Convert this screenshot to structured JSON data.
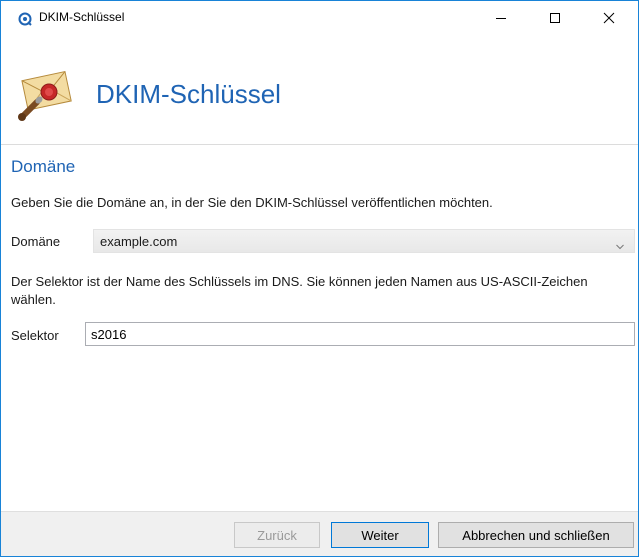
{
  "window": {
    "title": "DKIM-Schlüssel",
    "minimize_icon": "minimize-icon",
    "maximize_icon": "maximize-icon",
    "close_icon": "close-icon"
  },
  "header": {
    "title": "DKIM-Schlüssel",
    "icon": "sealed-envelope-icon"
  },
  "section": {
    "title": "Domäne",
    "description": "Geben Sie die Domäne an, in der Sie den DKIM-Schlüssel veröffentlichen möchten.",
    "domain_label": "Domäne",
    "domain_value": "example.com",
    "selector_description": "Der Selektor ist der Name des Schlüssels im DNS. Sie können jeden Namen aus US-ASCII-Zeichen wählen.",
    "selector_label": "Selektor",
    "selector_value": "s2016"
  },
  "footer": {
    "back_label": "Zurück",
    "next_label": "Weiter",
    "cancel_label": "Abbrechen und schließen"
  },
  "colors": {
    "accent": "#1f64b4",
    "window_border": "#1883d7",
    "footer_bg": "#f0f0f0"
  }
}
